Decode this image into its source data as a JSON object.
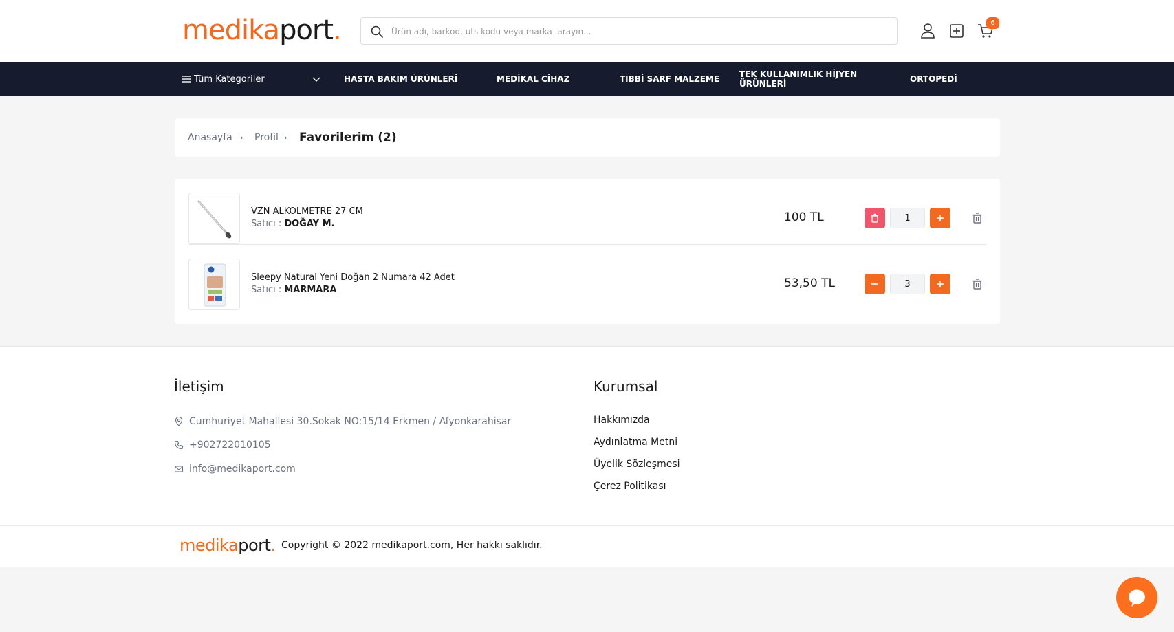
{
  "header": {
    "logo": {
      "part1": "medika",
      "part2": "port",
      "part3": "."
    },
    "search": {
      "placeholder": "Ürün adı, barkod, uts kodu veya marka  arayın..."
    },
    "cart_count": "6"
  },
  "navbar": {
    "all_categories": "Tüm Kategoriler",
    "items": [
      {
        "label": "HASTA BAKIM ÜRÜNLERİ"
      },
      {
        "label": "MEDİKAL CİHAZ"
      },
      {
        "label": "TIBBİ SARF MALZEME"
      },
      {
        "label": "TEK KULLANIMLIK HİJYEN ÜRÜNLERİ"
      },
      {
        "label": "ORTOPEDİ"
      }
    ]
  },
  "breadcrumb": {
    "home": "Anasayfa",
    "profile": "Profil",
    "current": "Favorilerim (2)"
  },
  "favorites": [
    {
      "name": "VZN ALKOLMETRE 27 CM",
      "seller_label": "Satıcı :",
      "seller": "DOĞAY M.",
      "price": "100 TL",
      "quantity": "1"
    },
    {
      "name": "Sleepy Natural Yeni Doğan 2 Numara 42 Adet",
      "seller_label": "Satıcı :",
      "seller": "MARMARA",
      "price": "53,50 TL",
      "quantity": "3"
    }
  ],
  "footer": {
    "contact": {
      "title": "İletişim",
      "address": "Cumhuriyet Mahallesi 30.Sokak NO:15/14 Erkmen / Afyonkarahisar",
      "phone": "+902722010105",
      "email": "info@medikaport.com"
    },
    "corporate": {
      "title": "Kurumsal",
      "links": [
        {
          "label": "Hakkımızda"
        },
        {
          "label": "Aydınlatma Metni"
        },
        {
          "label": "Üyelik Sözleşmesi"
        },
        {
          "label": "Çerez Politikası"
        }
      ]
    },
    "copyright": "Copyright © 2022 medikaport.com, Her hakkı saklıdır."
  },
  "colors": {
    "brand_orange": "#f26a21",
    "nav_bg": "#161c2d",
    "delete_red": "#f0566b"
  }
}
